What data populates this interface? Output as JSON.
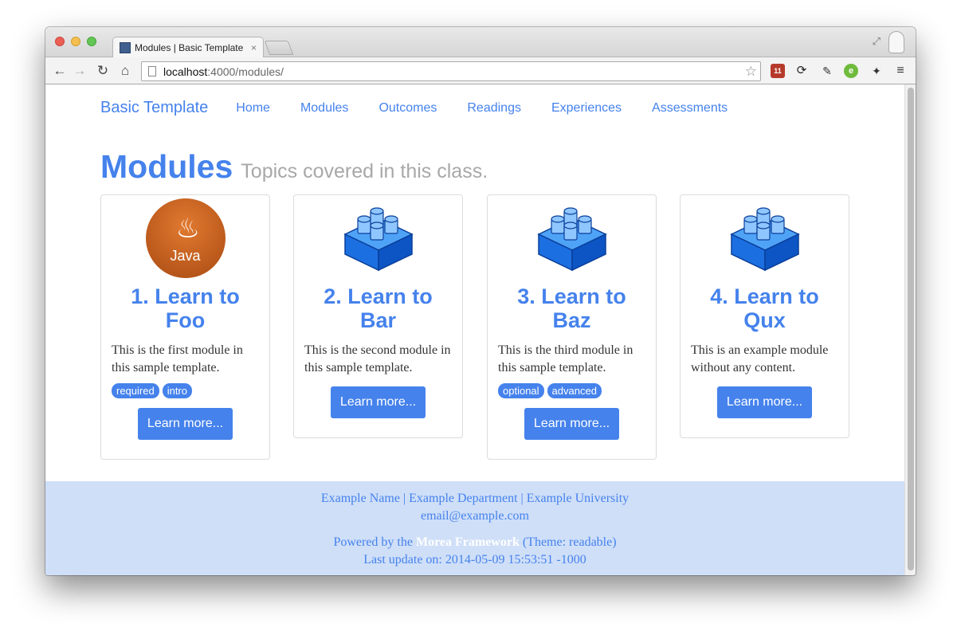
{
  "browser": {
    "tab_title": "Modules | Basic Template",
    "tab_close": "×",
    "url_host": "localhost",
    "url_rest": ":4000/modules/"
  },
  "page": {
    "brand": "Basic Template",
    "nav": [
      "Home",
      "Modules",
      "Outcomes",
      "Readings",
      "Experiences",
      "Assessments"
    ],
    "heading": "Modules",
    "subheading": "Topics covered in this class.",
    "modules": [
      {
        "title": "1. Learn to Foo",
        "icon": "java-logo",
        "icon_text": "Java",
        "description": "This is the first module in this sample template.",
        "labels": [
          "required",
          "intro"
        ],
        "button": "Learn more..."
      },
      {
        "title": "2. Learn to Bar",
        "icon": "blocks-icon",
        "description": "This is the second module in this sample template.",
        "labels": [],
        "button": "Learn more..."
      },
      {
        "title": "3. Learn to Baz",
        "icon": "blocks-icon",
        "description": "This is the third module in this sample template.",
        "labels": [
          "optional",
          "advanced"
        ],
        "button": "Learn more..."
      },
      {
        "title": "4. Learn to Qux",
        "icon": "blocks-icon",
        "description": "This is an example module without any content.",
        "labels": [],
        "button": "Learn more..."
      }
    ]
  },
  "footer": {
    "line1": "Example Name | Example Department | Example University",
    "email": "email@example.com",
    "powered_prefix": "Powered by the ",
    "powered_link": "Morea Framework",
    "powered_suffix": " (Theme: readable)",
    "last_update": "Last update on: 2014-05-09 15:53:51 -1000"
  },
  "colors": {
    "accent": "#4582ec",
    "footer_bg": "#cfdff8",
    "muted": "#a8a8a8"
  }
}
